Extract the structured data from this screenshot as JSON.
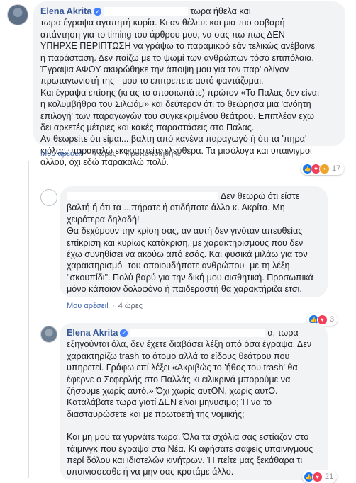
{
  "comments": [
    {
      "author": "Elena Akrita",
      "lines": [
        "τωρα ήθελα και",
        "τωρα έγραψα αγαπητή κυρία. Κι αν θέλετε και μια πιο σοβαρή",
        "απάντηση για το timing του άρθρου μου, να σας πω πως ΔΕΝ",
        "ΥΠΗΡΧΕ ΠΕΡΙΠΤΩΣΗ να γράψω το παραμικρό εάν τελικώς ανέβαινε",
        "η παράσταση. Δεν παίζω με το ψωμί των ανθρώπων τόσο επιπόλαια.",
        "Έγραψα ΑΦΟΥ ακυρώθηκε την άποψη μου για τον παρ' ολίγον",
        "πρωταγωνιστή της - μου το επιτρεπετε αυτό φαντάζομαι.",
        "Και έγραψα επίσης (κι ας το αποσιωπάτε) πρώτον «Το Παλας δεν είναι",
        "η κολυμβήθρα του Σιλωάμ» και δεύτερον ότι το θεώρησα μια 'ανόητη",
        "επιλογή' των παραγωγών του συγκεκριμένου θεάτρου. Επιπλέον εχω",
        "δει αρκετές μέτριες και κακές παραστάσεις στο Παλας.",
        "Αν θεωρείτε ότι είμαι... βαλτή από κανένα παραγωγό ή ότι τα 'πηρα'",
        "κιόλας, παρακαλώ εκφραστείτε ελεύθερα. Τα μισόλογα και υπαινιγμοί",
        "αλλού, όχι εδώ παρακαλώ πολύ."
      ],
      "like_label": "Μου αρέσει!",
      "time": "4 ώρες",
      "edited_label": "Τροποποιήθηκε",
      "reaction_count": "17"
    },
    {
      "lines": [
        "Δεν θεωρώ ότι είστε",
        "βαλτή ή ότι τα ...πήρατε ή οτιδήποτε άλλο κ. Ακρίτα. Μη",
        "χειρότερα δηλαδή!",
        "Θα δεχόμουν την κρίση σας, αν αυτή δεν γινόταν απευθείας",
        "επίκριση και κυρίως κατάκριση, με χαρακτηρισμούς που δεν",
        "έχω συνηθίσει να ακούω από εσάς. Και φυσικά μιλάω για τον",
        "χαρακτηρισμό -του οποιουδήποτε ανθρώπου- με τη λέξη",
        "\"σκουπίδι\". Πολύ βαρύ για την δική μου αισθητική. Προσωπικά",
        "μόνο κάποιον δολοφόνο ή παιδεραστή θα χαρακτήριζα έτσι."
      ],
      "like_label": "Μου αρέσει!",
      "time": "4 ώρες",
      "reaction_count": "3"
    },
    {
      "author": "Elena Akrita",
      "lines": [
        "α, τωρα",
        "εξηγούνται όλα, δεν έχετε διαβάσει λέξη από όσα έγραψα. Δεν",
        "χαρακτηρίζω trash το άτομο αλλά το είδους θεάτρου που",
        "υπηρετεί. Γράφω επί λέξει «Ακριβώς το 'ήθος του trash' θα",
        "έφερνε ο Σεφερλής στο Παλλάς κι ειλικρινά μπορούμε να",
        "ζήσουμε χωρίς αυτό.» Όχι χωρίς αυτΟΝ, χωρίς αυτΟ.",
        "Καταλάβατε τωρα γιατί ΔΕΝ είναι μηνυσιμο; Ή να το",
        "διασταυρώσετε και με πρωτοετή της νομικής;",
        "",
        "Και μη μου τα γυρνάτε τωρα. Όλα τα σχόλια σας εστίαζαν στο",
        "τάιμινγκ που έγραψα στα Νέα. Κι αφήσατε σαφείς υπαινιγμούς",
        "περί δόλου και ιδιοτελών κινήτρων. Ή πείτε μας ξεκάθαρα τι",
        "υπαινισσεσθε ή να μην σας κρατάμε άλλο."
      ],
      "reaction_count": "21"
    }
  ]
}
